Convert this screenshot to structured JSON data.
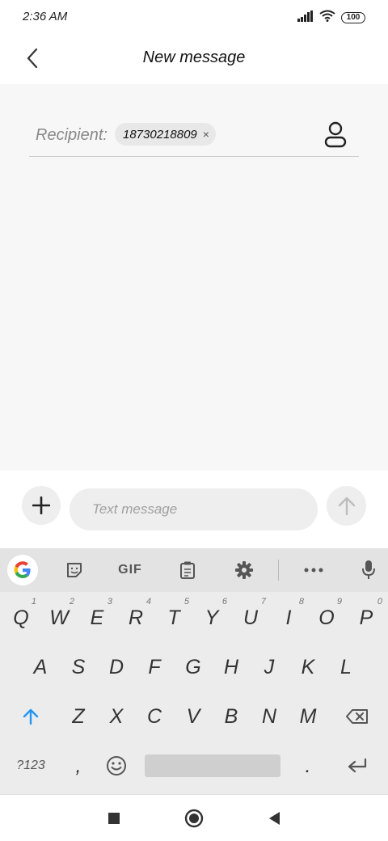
{
  "status": {
    "time": "2:36 AM",
    "battery": "100",
    "icons": [
      "signal-icon",
      "wifi-icon",
      "battery-icon"
    ]
  },
  "header": {
    "title": "New message",
    "back_icon": "chevron-left-icon"
  },
  "recipient": {
    "label": "Recipient:",
    "chip": "18730218809",
    "chip_close": "×",
    "contact_icon": "person-icon"
  },
  "compose": {
    "placeholder": "Text message",
    "add_icon": "plus-icon",
    "send_icon": "arrow-up-icon"
  },
  "keyboard": {
    "toolbar": {
      "gif": "GIF",
      "icons": [
        "google-icon",
        "sticker-icon",
        "gif-icon",
        "clipboard-icon",
        "gear-icon",
        "more-icon",
        "mic-icon"
      ]
    },
    "row1": [
      "Q",
      "W",
      "E",
      "R",
      "T",
      "Y",
      "U",
      "I",
      "O",
      "P"
    ],
    "row1_hints": [
      "1",
      "2",
      "3",
      "4",
      "5",
      "6",
      "7",
      "8",
      "9",
      "0"
    ],
    "row2": [
      "A",
      "S",
      "D",
      "F",
      "G",
      "H",
      "J",
      "K",
      "L"
    ],
    "row3": [
      "Z",
      "X",
      "C",
      "V",
      "B",
      "N",
      "M"
    ],
    "bottom": {
      "symbols": "?123",
      "comma": ",",
      "period": "."
    }
  },
  "colors": {
    "accent": "#2196f3",
    "background": "#f7f7f7",
    "keyboard": "#ececec"
  }
}
